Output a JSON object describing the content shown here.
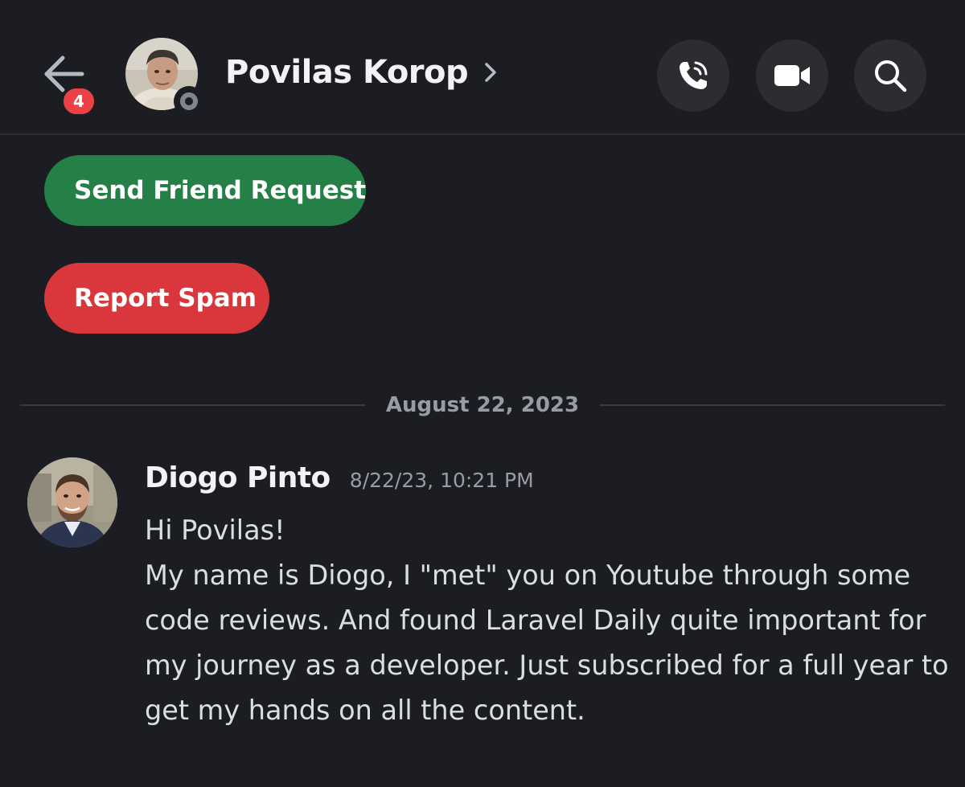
{
  "header": {
    "back_badge_count": "4",
    "contact_name": "Povilas Korop",
    "status": "offline",
    "actions": [
      {
        "name": "voice-call",
        "icon": "phone-call-icon"
      },
      {
        "name": "video-call",
        "icon": "video-camera-icon"
      },
      {
        "name": "search",
        "icon": "search-icon"
      }
    ]
  },
  "actions": {
    "friend_request_label": "Send Friend Request",
    "report_spam_label": "Report Spam"
  },
  "divider": {
    "date": "August 22, 2023"
  },
  "message": {
    "author": "Diogo Pinto",
    "timestamp": "8/22/23, 10:21 PM",
    "paragraphs": [
      "Hi Povilas!",
      "My name is Diogo, I \"met\" you on Youtube through some code reviews. And found Laravel Daily quite important for my journey as a developer. Just subscribed for a full year to get my hands on all the content."
    ]
  },
  "colors": {
    "background": "#1c1d22",
    "friend_button": "#248046",
    "spam_button": "#da373c",
    "badge": "#ed4245",
    "icon_button": "#2b2d31"
  }
}
